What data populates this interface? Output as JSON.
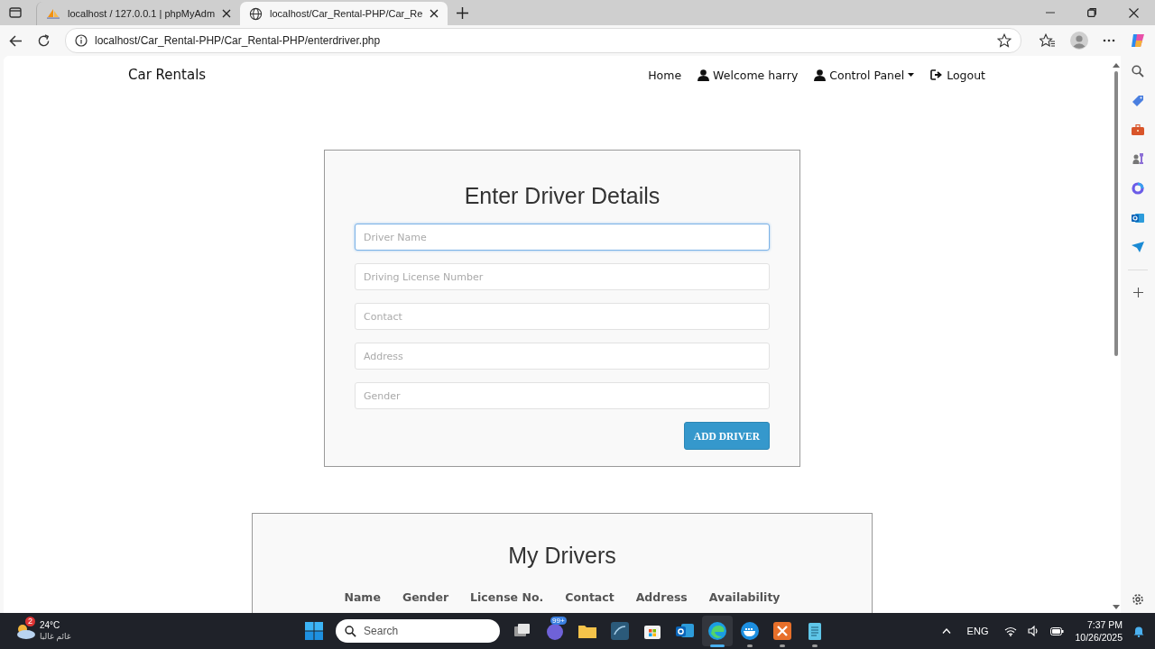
{
  "browser": {
    "tabs": [
      {
        "title": "localhost / 127.0.0.1 | phpMyAdm",
        "selected": false
      },
      {
        "title": "localhost/Car_Rental-PHP/Car_Re",
        "selected": true
      }
    ],
    "url": "localhost/Car_Rental-PHP/Car_Rental-PHP/enterdriver.php"
  },
  "navbar": {
    "brand": "Car Rentals",
    "items": [
      {
        "label": "Home",
        "kind": "plain",
        "dropdown": false
      },
      {
        "label": "Welcome harry",
        "kind": "user",
        "dropdown": false
      },
      {
        "label": "Control Panel",
        "kind": "user",
        "dropdown": true
      },
      {
        "label": "Logout",
        "kind": "logout",
        "dropdown": false
      }
    ]
  },
  "driver_form": {
    "title": "Enter Driver Details",
    "fields": [
      {
        "placeholder": "Driver Name",
        "focused": true
      },
      {
        "placeholder": "Driving License Number",
        "focused": false
      },
      {
        "placeholder": "Contact",
        "focused": false
      },
      {
        "placeholder": "Address",
        "focused": false
      },
      {
        "placeholder": "Gender",
        "focused": false
      }
    ],
    "submit": "ADD DRIVER"
  },
  "drivers_table": {
    "title": "My Drivers",
    "columns": [
      "Name",
      "Gender",
      "License No.",
      "Contact",
      "Address",
      "Availability"
    ]
  },
  "taskbar": {
    "weather": {
      "badge": "2",
      "temperature": "24°C",
      "condition": "غائم غالبا"
    },
    "search": {
      "placeholder": "Search"
    },
    "apps": [
      {
        "kind": "taskview",
        "running": false,
        "selected": false
      },
      {
        "kind": "chat",
        "running": false,
        "selected": false,
        "badge": "99+"
      },
      {
        "kind": "folder",
        "running": false,
        "selected": false
      },
      {
        "kind": "database",
        "running": false,
        "selected": false
      },
      {
        "kind": "store",
        "running": false,
        "selected": false
      },
      {
        "kind": "mail",
        "running": false,
        "selected": false
      },
      {
        "kind": "browser",
        "running": true,
        "selected": true
      },
      {
        "kind": "whale",
        "running": true,
        "selected": false
      },
      {
        "kind": "xampp",
        "running": true,
        "selected": false
      },
      {
        "kind": "notepad",
        "running": true,
        "selected": false
      }
    ],
    "language": "ENG",
    "time": "7:37 PM",
    "date": "10/26/2025"
  }
}
